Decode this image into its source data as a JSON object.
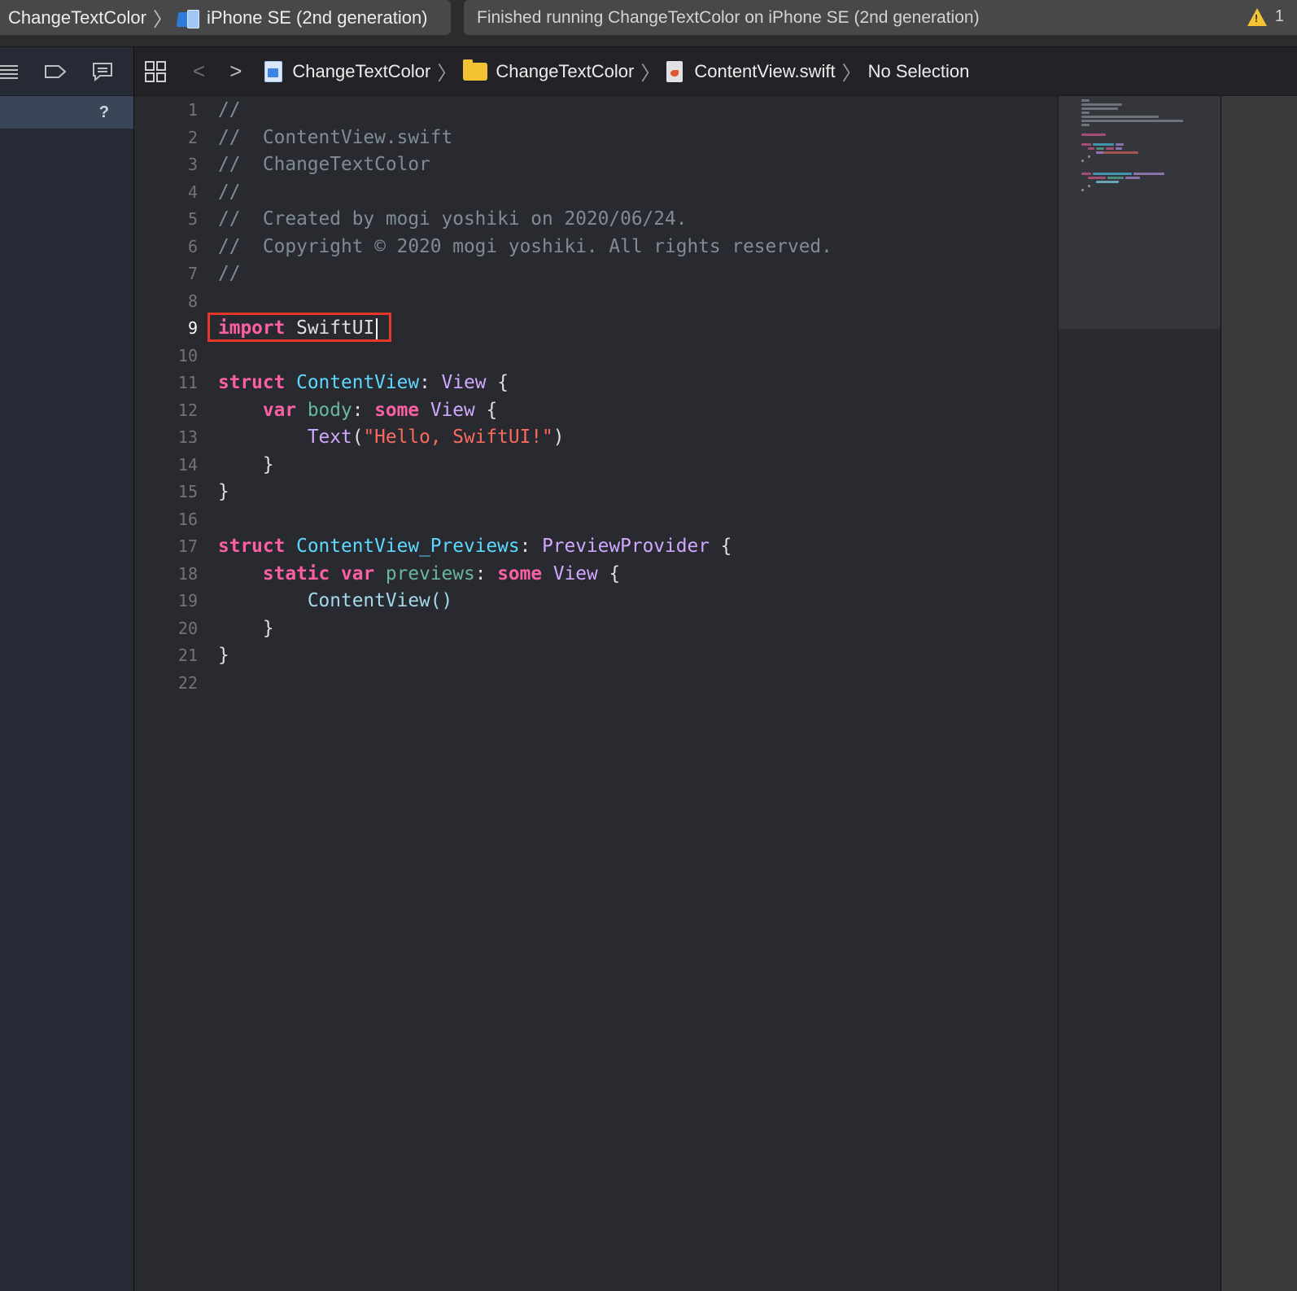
{
  "toolbar": {
    "scheme_name": "ChangeTextColor",
    "device_name": "iPhone SE (2nd generation)",
    "status_text": "Finished running ChangeTextColor on iPhone SE (2nd generation)",
    "warning_count": "1"
  },
  "navigator": {
    "help_label": "?"
  },
  "jumpbar": {
    "project": "ChangeTextColor",
    "group": "ChangeTextColor",
    "file": "ContentView.swift",
    "selection": "No Selection"
  },
  "editor": {
    "line_numbers": [
      "1",
      "2",
      "3",
      "4",
      "5",
      "6",
      "7",
      "8",
      "9",
      "10",
      "11",
      "12",
      "13",
      "14",
      "15",
      "16",
      "17",
      "18",
      "19",
      "20",
      "21",
      "22"
    ],
    "current_line": "9",
    "lines": {
      "l1": "//",
      "l2": "//  ContentView.swift",
      "l3": "//  ChangeTextColor",
      "l4": "//",
      "l5": "//  Created by mogi yoshiki on 2020/06/24.",
      "l6": "//  Copyright © 2020 mogi yoshiki. All rights reserved.",
      "l7": "//",
      "l9_kw": "import",
      "l9_mod": "SwiftUI",
      "l11_kw": "struct",
      "l11_name": "ContentView",
      "l11_colon": ":",
      "l11_type": "View",
      "l11_brace": "{",
      "l12_kw": "var",
      "l12_name": "body",
      "l12_colon": ":",
      "l12_some": "some",
      "l12_type": "View",
      "l12_brace": "{",
      "l13_fn": "Text",
      "l13_open": "(",
      "l13_str": "\"Hello, SwiftUI!\"",
      "l13_close": ")",
      "l14": "}",
      "l15": "}",
      "l17_kw": "struct",
      "l17_name": "ContentView_Previews",
      "l17_colon": ":",
      "l17_type": "PreviewProvider",
      "l17_brace": "{",
      "l18_static": "static",
      "l18_var": "var",
      "l18_name": "previews",
      "l18_colon": ":",
      "l18_some": "some",
      "l18_type": "View",
      "l18_brace": "{",
      "l19": "ContentView()",
      "l20": "}",
      "l21": "}"
    }
  },
  "colors": {
    "keyword": "#fc5fa3",
    "type_decl": "#5dd8ff",
    "system_type": "#d0a8ff",
    "string": "#fc6a5d",
    "comment": "#7f8c98",
    "highlight_box": "#e5382a"
  }
}
